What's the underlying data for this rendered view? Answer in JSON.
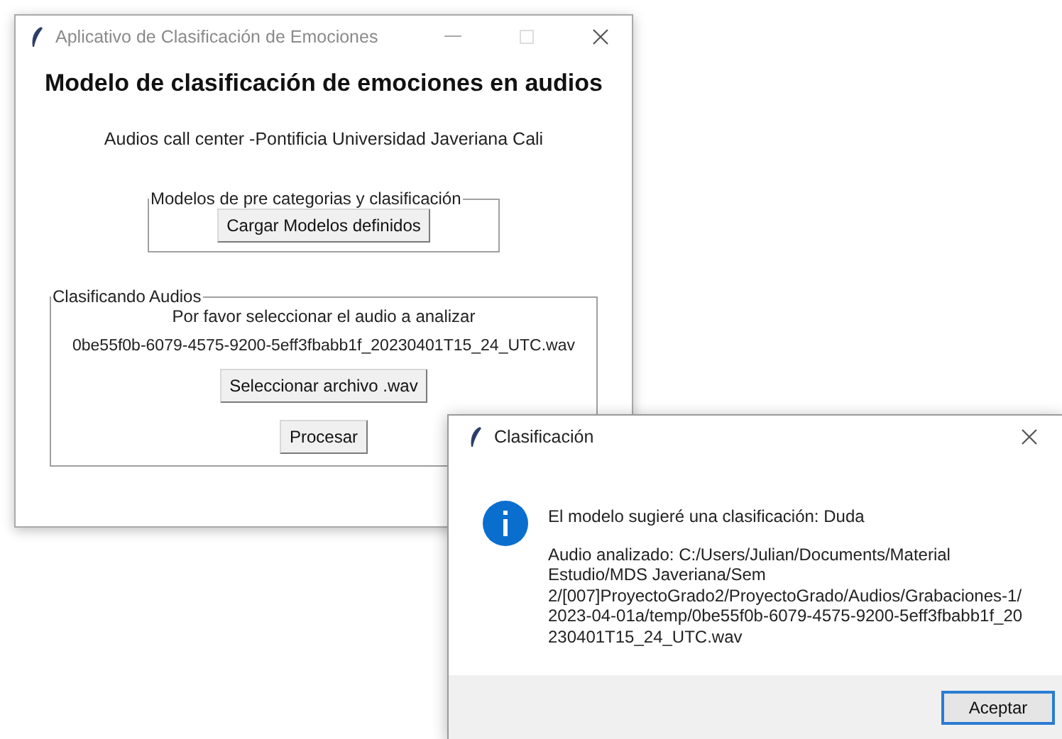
{
  "main_window": {
    "title": "Aplicativo de Clasificación de Emociones",
    "heading": "Modelo de clasificación de emociones en audios",
    "subtitle": "Audios call center -Pontificia Universidad Javeriana Cali",
    "models_frame": {
      "legend": "Modelos de pre categorias y clasificación",
      "button": "Cargar Modelos definidos"
    },
    "classify_frame": {
      "legend": "Clasificando Audios",
      "instruction": "Por favor seleccionar el audio a analizar",
      "file_name": "0be55f0b-6079-4575-9200-5eff3fbabb1f_20230401T15_24_UTC.wav",
      "select_button": "Seleccionar archivo .wav",
      "process_button": "Procesar"
    }
  },
  "dialog": {
    "title": "Clasificación",
    "message": "El modelo sugieré una clasificación: Duda",
    "detail_lines": [
      "Audio analizado: C:/Users/Julian/Documents/Material",
      "Estudio/MDS Javeriana/Sem",
      "2/[007]ProyectoGrado2/ProyectoGrado/Audios/Grabaciones-1/",
      "2023-04-01a/temp/0be55f0b-6079-4575-9200-5eff3fbabb1f_20",
      "230401T15_24_UTC.wav"
    ],
    "button": "Aceptar"
  }
}
